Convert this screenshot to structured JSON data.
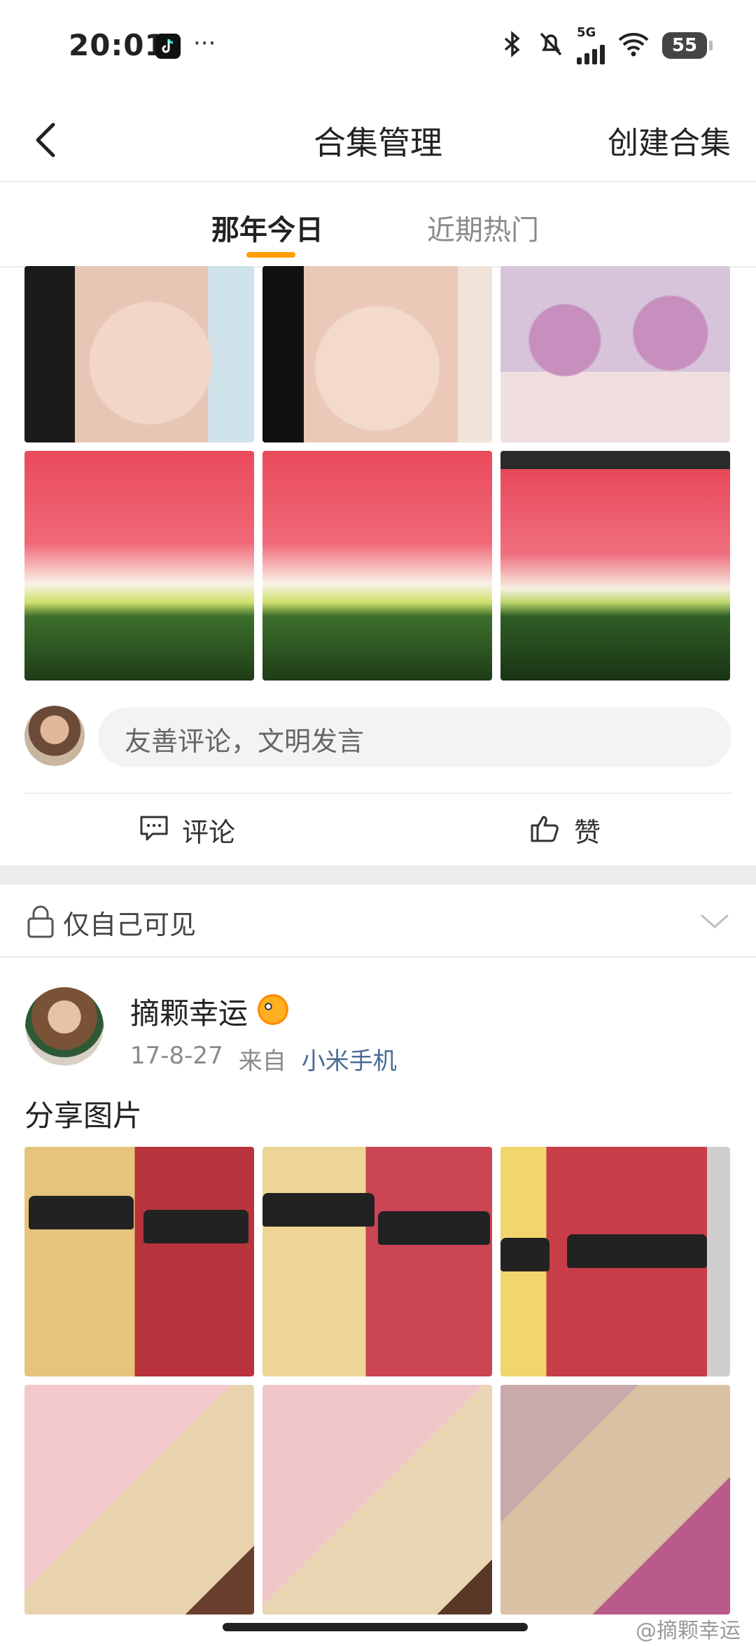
{
  "status_bar": {
    "time": "20:01",
    "dots": "···",
    "network": "5G",
    "battery": "55"
  },
  "header": {
    "title": "合集管理",
    "create_label": "创建合集"
  },
  "tabs": [
    {
      "label": "那年今日",
      "active": true
    },
    {
      "label": "近期热门",
      "active": false
    }
  ],
  "comment_box": {
    "placeholder": "友善评论，文明发言"
  },
  "actions": {
    "comment_label": "评论",
    "like_label": "赞"
  },
  "visibility": {
    "label": "仅自己可见"
  },
  "post": {
    "username": "摘颗幸运",
    "date": "17-8-27",
    "from_label": "来自",
    "source": "小米手机",
    "text": "分享图片"
  },
  "watermark": "@摘颗幸运",
  "colors": {
    "accent": "#ff9d00",
    "link": "#4a6b95"
  }
}
